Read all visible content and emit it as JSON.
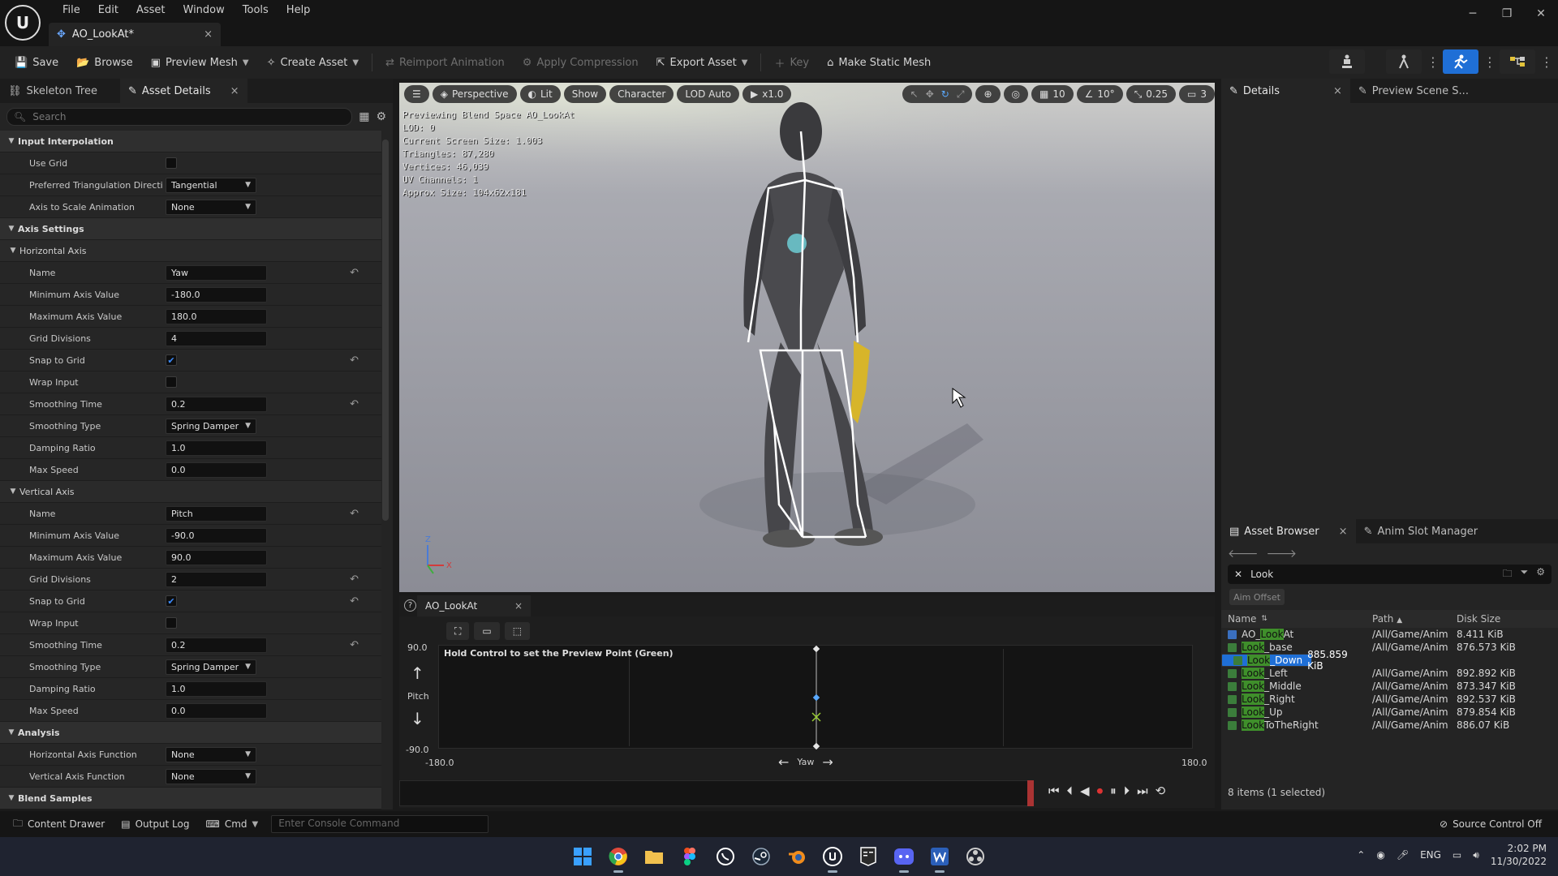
{
  "menu": [
    "File",
    "Edit",
    "Asset",
    "Window",
    "Tools",
    "Help"
  ],
  "doc_tab": {
    "title": "AO_LookAt*",
    "close": "×"
  },
  "window_controls": {
    "minimize": "─",
    "restore": "❐",
    "close": "✕"
  },
  "toolbar": {
    "save": "Save",
    "browse": "Browse",
    "preview_mesh": "Preview Mesh",
    "create_asset": "Create Asset",
    "reimport": "Reimport Animation",
    "apply_compression": "Apply Compression",
    "export_asset": "Export Asset",
    "key": "Key",
    "make_static_mesh": "Make Static Mesh"
  },
  "left_tabs": {
    "skeleton_tree": "Skeleton Tree",
    "asset_details": "Asset Details",
    "close": "×"
  },
  "search": {
    "placeholder": "Search"
  },
  "properties": [
    {
      "type": "section",
      "label": "Input Interpolation"
    },
    {
      "type": "check",
      "label": "Use Grid",
      "checked": false
    },
    {
      "type": "select",
      "label": "Preferred Triangulation Directi...",
      "value": "Tangential"
    },
    {
      "type": "select",
      "label": "Axis to Scale Animation",
      "value": "None"
    },
    {
      "type": "section",
      "label": "Axis Settings"
    },
    {
      "type": "sub",
      "label": "Horizontal Axis"
    },
    {
      "type": "input",
      "label": "Name",
      "value": "Yaw",
      "reset": true
    },
    {
      "type": "input",
      "label": "Minimum Axis Value",
      "value": "-180.0"
    },
    {
      "type": "input",
      "label": "Maximum Axis Value",
      "value": "180.0"
    },
    {
      "type": "input",
      "label": "Grid Divisions",
      "value": "4"
    },
    {
      "type": "check",
      "label": "Snap to Grid",
      "checked": true,
      "reset": true
    },
    {
      "type": "check",
      "label": "Wrap Input",
      "checked": false
    },
    {
      "type": "input",
      "label": "Smoothing Time",
      "value": "0.2",
      "reset": true
    },
    {
      "type": "select",
      "label": "Smoothing Type",
      "value": "Spring Damper"
    },
    {
      "type": "input",
      "label": "Damping Ratio",
      "value": "1.0"
    },
    {
      "type": "input",
      "label": "Max Speed",
      "value": "0.0"
    },
    {
      "type": "sub",
      "label": "Vertical Axis"
    },
    {
      "type": "input",
      "label": "Name",
      "value": "Pitch",
      "reset": true
    },
    {
      "type": "input",
      "label": "Minimum Axis Value",
      "value": "-90.0"
    },
    {
      "type": "input",
      "label": "Maximum Axis Value",
      "value": "90.0"
    },
    {
      "type": "input",
      "label": "Grid Divisions",
      "value": "2",
      "reset": true
    },
    {
      "type": "check",
      "label": "Snap to Grid",
      "checked": true,
      "reset": true
    },
    {
      "type": "check",
      "label": "Wrap Input",
      "checked": false
    },
    {
      "type": "input",
      "label": "Smoothing Time",
      "value": "0.2",
      "reset": true
    },
    {
      "type": "select",
      "label": "Smoothing Type",
      "value": "Spring Damper"
    },
    {
      "type": "input",
      "label": "Damping Ratio",
      "value": "1.0"
    },
    {
      "type": "input",
      "label": "Max Speed",
      "value": "0.0"
    },
    {
      "type": "section",
      "label": "Analysis"
    },
    {
      "type": "select",
      "label": "Horizontal Axis Function",
      "value": "None"
    },
    {
      "type": "select",
      "label": "Vertical Axis Function",
      "value": "None"
    },
    {
      "type": "section",
      "label": "Blend Samples"
    }
  ],
  "viewport": {
    "perspective": "Perspective",
    "lit": "Lit",
    "show": "Show",
    "character": "Character",
    "lod": "LOD Auto",
    "speed": "x1.0",
    "snap_grid": "10",
    "snap_angle": "10°",
    "snap_scale": "0.25",
    "camera_speed": "3",
    "info": [
      "Previewing Blend Space AO_LookAt",
      "LOD: 0",
      "Current Screen Size: 1.003",
      "Triangles: 87,280",
      "Vertices: 46,039",
      "UV Channels: 1",
      "Approx Size: 104x62x181"
    ],
    "gizmo": {
      "z": "Z",
      "x": "X"
    }
  },
  "blendspace": {
    "tab": "AO_LookAt",
    "close": "×",
    "hint": "Hold Control to set the Preview Point (Green)",
    "y_max": "90.0",
    "y_min": "-90.0",
    "y_label": "Pitch",
    "x_min": "-180.0",
    "x_max": "180.0",
    "x_label": "Yaw",
    "samples": [
      {
        "yaw": 0,
        "pitch": 90
      },
      {
        "yaw": 0,
        "pitch": 0
      },
      {
        "yaw": 0,
        "pitch": -90
      }
    ],
    "preview_point": {
      "yaw": 0,
      "pitch": -36
    }
  },
  "details_tabs": {
    "details": "Details",
    "preview_scene": "Preview Scene S...",
    "close": "×"
  },
  "asset_browser": {
    "tab": "Asset Browser",
    "close": "×",
    "anim_slot": "Anim Slot Manager",
    "search_value": "Look",
    "filter": "Aim Offset",
    "headers": {
      "name": "Name",
      "path": "Path",
      "size": "Disk Size"
    },
    "items": [
      {
        "pre": "AO_",
        "hl": "Look",
        "post": "At",
        "path": "/All/Game/Anim",
        "size": "8.411 KiB"
      },
      {
        "pre": "",
        "hl": "Look",
        "post": "_base",
        "path": "/All/Game/Anim",
        "size": "876.573 KiB"
      },
      {
        "pre": "",
        "hl": "Look",
        "post": "_Down",
        "path": "/All/Game/Anim",
        "size": "885.859 KiB",
        "selected": true
      },
      {
        "pre": "",
        "hl": "Look",
        "post": "_Left",
        "path": "/All/Game/Anim",
        "size": "892.892 KiB"
      },
      {
        "pre": "",
        "hl": "Look",
        "post": "_Middle",
        "path": "/All/Game/Anim",
        "size": "873.347 KiB"
      },
      {
        "pre": "",
        "hl": "Look",
        "post": "_Right",
        "path": "/All/Game/Anim",
        "size": "892.537 KiB"
      },
      {
        "pre": "",
        "hl": "Look",
        "post": "_Up",
        "path": "/All/Game/Anim",
        "size": "879.854 KiB"
      },
      {
        "pre": "",
        "hl": "Look",
        "post": "ToTheRight",
        "path": "/All/Game/Anim",
        "size": "886.07 KiB"
      }
    ],
    "footer": "8 items (1 selected)"
  },
  "statusbar": {
    "content_drawer": "Content Drawer",
    "output_log": "Output Log",
    "cmd": "Cmd",
    "console_placeholder": "Enter Console Command",
    "source_control": "Source Control Off"
  },
  "taskbar": {
    "lang": "ENG",
    "time": "2:02 PM",
    "date": "11/30/2022"
  }
}
